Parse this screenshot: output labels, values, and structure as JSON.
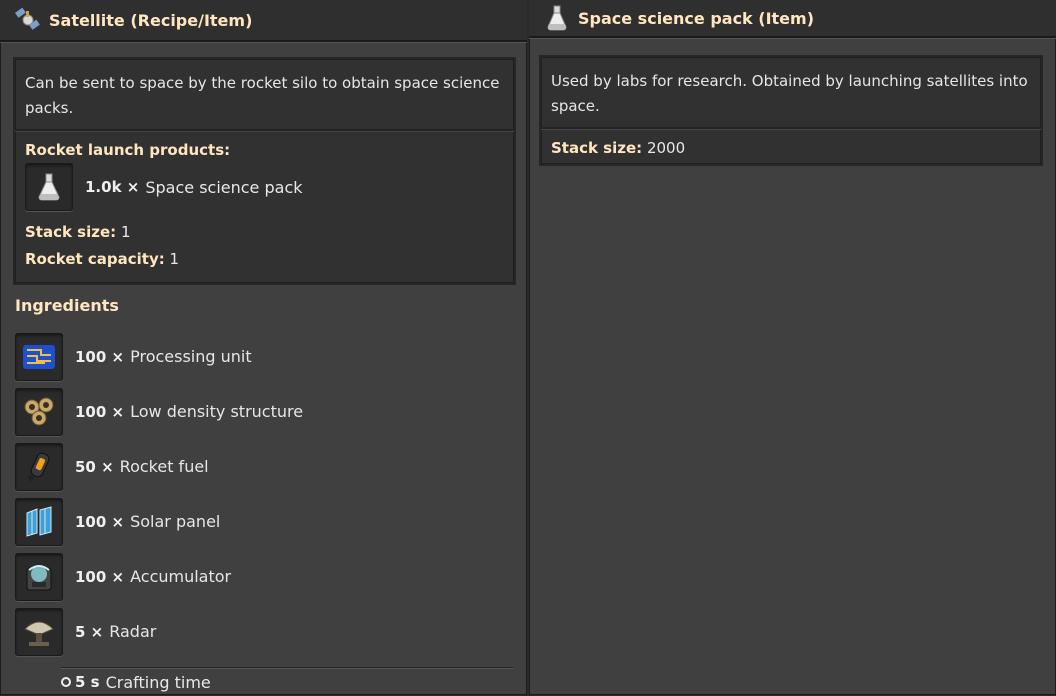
{
  "left_panel": {
    "title": "Satellite (Recipe/Item)",
    "title_icon": "satellite-icon",
    "description": "Can be sent to space by the rocket silo to obtain space science packs.",
    "launch_products_label": "Rocket launch products:",
    "product": {
      "icon": "space-science-pack-icon",
      "quantity": "1.0k ×",
      "name": "Space science pack"
    },
    "stack_size_label": "Stack size:",
    "stack_size_value": "1",
    "rocket_capacity_label": "Rocket capacity:",
    "rocket_capacity_value": "1",
    "ingredients_title": "Ingredients",
    "ingredients": [
      {
        "quantity": "100 ×",
        "name": "Processing unit",
        "icon": "processing-unit-icon"
      },
      {
        "quantity": "100 ×",
        "name": "Low density structure",
        "icon": "low-density-structure-icon"
      },
      {
        "quantity": "50 ×",
        "name": "Rocket fuel",
        "icon": "rocket-fuel-icon"
      },
      {
        "quantity": "100 ×",
        "name": "Solar panel",
        "icon": "solar-panel-icon"
      },
      {
        "quantity": "100 ×",
        "name": "Accumulator",
        "icon": "accumulator-icon"
      },
      {
        "quantity": "5 ×",
        "name": "Radar",
        "icon": "radar-icon"
      }
    ],
    "crafting_time_value": "5 s",
    "crafting_time_label": "Crafting time"
  },
  "right_panel": {
    "title": "Space science pack (Item)",
    "title_icon": "space-science-pack-icon",
    "description": "Used by labs for research. Obtained by launching satellites into space.",
    "stack_size_label": "Stack size:",
    "stack_size_value": "2000"
  },
  "colors": {
    "label": "#ffe6c0",
    "panel": "#404040",
    "box": "#313131"
  }
}
